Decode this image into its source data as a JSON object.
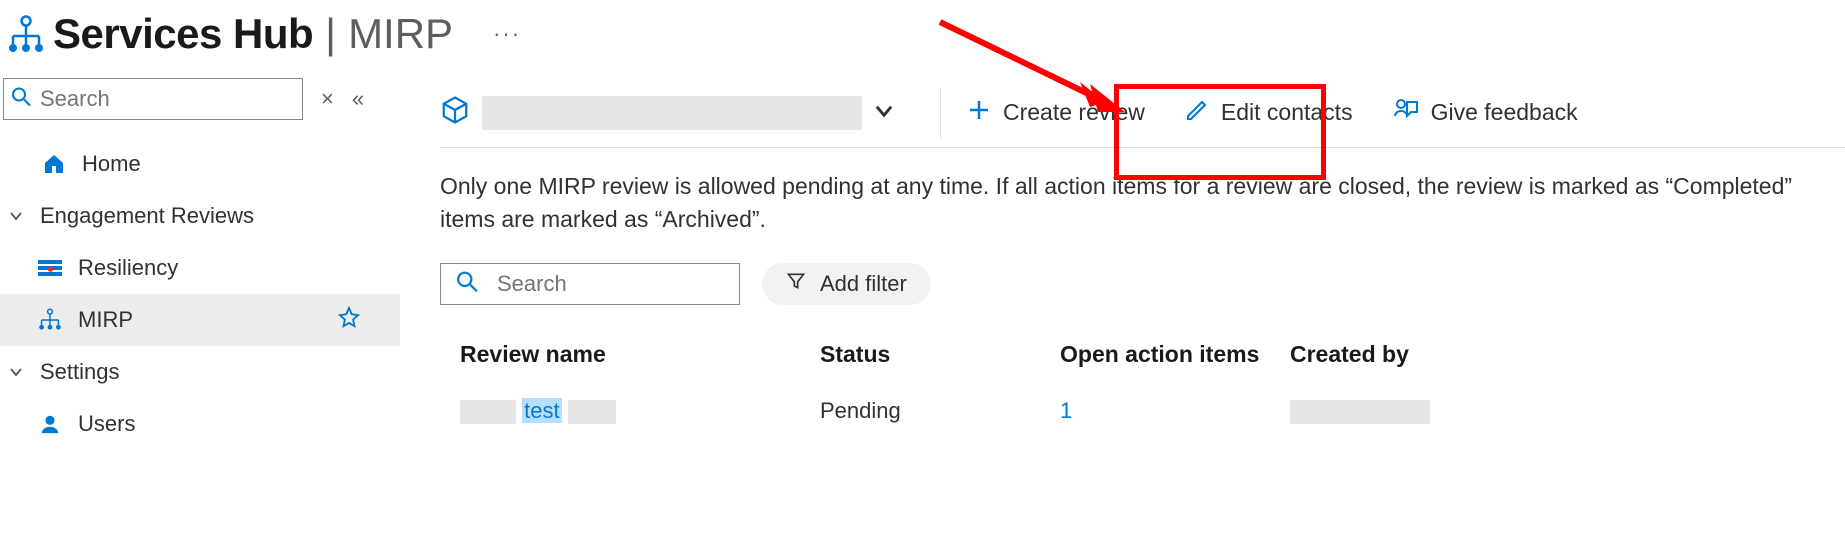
{
  "header": {
    "title": "Services Hub",
    "breadcrumb_sep": "|",
    "breadcrumb_current": "MIRP",
    "more": "···"
  },
  "sidebar": {
    "search_placeholder": "Search",
    "close_label": "×",
    "collapse_label": "«",
    "items": [
      {
        "label": "Home"
      },
      {
        "label": "Engagement Reviews"
      },
      {
        "label": "Resiliency"
      },
      {
        "label": "MIRP"
      },
      {
        "label": "Settings"
      },
      {
        "label": "Users"
      }
    ]
  },
  "cmdbar": {
    "scope_chevron": "⌄",
    "create_review": "Create review",
    "edit_contacts": "Edit contacts",
    "give_feedback": "Give feedback"
  },
  "info_text": "Only one MIRP review is allowed pending at any time. If all action items for a review are closed, the review is marked as “Completed” items are marked as “Archived”.",
  "filters": {
    "search_placeholder": "Search",
    "add_filter": "Add filter"
  },
  "table": {
    "headers": {
      "name": "Review name",
      "status": "Status",
      "open": "Open action items",
      "created": "Created by"
    },
    "rows": [
      {
        "name_visible": "test",
        "status": "Pending",
        "open": "1"
      }
    ]
  },
  "colors": {
    "accent": "#0078d4",
    "annotation": "#ff0000"
  }
}
